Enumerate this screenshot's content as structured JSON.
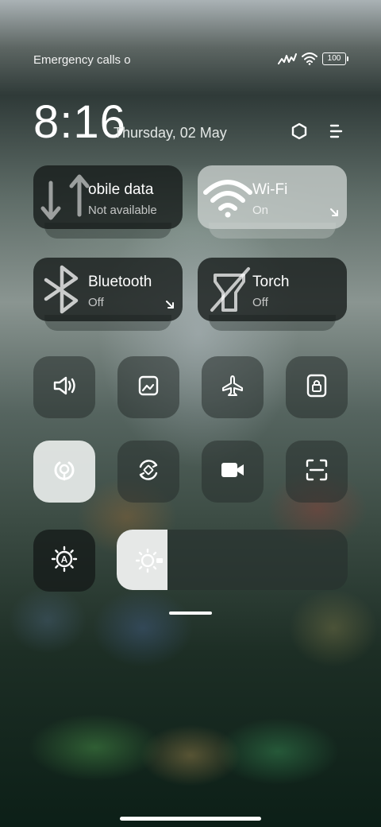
{
  "status": {
    "carrier_text": "Emergency calls o",
    "battery": "100"
  },
  "header": {
    "time": "8:16",
    "date": "Thursday, 02 May"
  },
  "tiles": [
    {
      "title": "obile data",
      "subtitle": "Not available",
      "icon": "mobile-data-icon",
      "state": "off"
    },
    {
      "title": "Wi-Fi",
      "subtitle": "On",
      "icon": "wifi-icon",
      "state": "on"
    },
    {
      "title": "Bluetooth",
      "subtitle": "Off",
      "icon": "bluetooth-icon",
      "state": "off"
    },
    {
      "title": "Torch",
      "subtitle": "Off",
      "icon": "torch-off-icon",
      "state": "off"
    }
  ],
  "toggles": [
    {
      "icon": "sound-icon",
      "state": "off"
    },
    {
      "icon": "screenshot-icon",
      "state": "off"
    },
    {
      "icon": "airplane-mode-icon",
      "state": "off"
    },
    {
      "icon": "lock-screen-icon",
      "state": "off"
    },
    {
      "icon": "location-icon",
      "state": "on"
    },
    {
      "icon": "auto-rotate-icon",
      "state": "off"
    },
    {
      "icon": "screen-recorder-icon",
      "state": "off"
    },
    {
      "icon": "scanner-icon",
      "state": "off"
    }
  ],
  "brightness": {
    "level": 0.22,
    "auto_icon": "auto-brightness-icon"
  },
  "colors": {
    "accent_on": "#e4e8e6",
    "tile_dark": "#141a18"
  }
}
